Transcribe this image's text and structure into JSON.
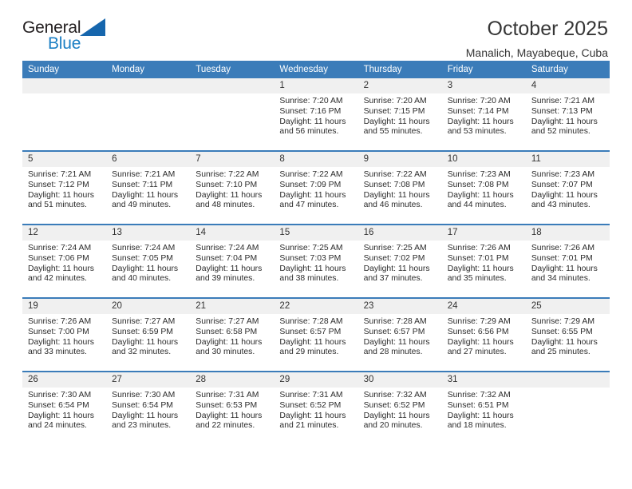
{
  "brand": {
    "name_top": "General",
    "name_bottom": "Blue",
    "accent_color": "#1666ad",
    "blue_text_color": "#1b7fc4"
  },
  "header": {
    "title": "October 2025",
    "subtitle": "Manalich, Mayabeque, Cuba"
  },
  "calendar": {
    "header_bg": "#3B7CB9",
    "daynum_bg": "#F0F0F0",
    "weekday_headers": [
      "Sunday",
      "Monday",
      "Tuesday",
      "Wednesday",
      "Thursday",
      "Friday",
      "Saturday"
    ],
    "weeks": [
      [
        {
          "day": "",
          "sunrise": "",
          "sunset": "",
          "daylight_line1": "",
          "daylight_line2": ""
        },
        {
          "day": "",
          "sunrise": "",
          "sunset": "",
          "daylight_line1": "",
          "daylight_line2": ""
        },
        {
          "day": "",
          "sunrise": "",
          "sunset": "",
          "daylight_line1": "",
          "daylight_line2": ""
        },
        {
          "day": "1",
          "sunrise": "Sunrise: 7:20 AM",
          "sunset": "Sunset: 7:16 PM",
          "daylight_line1": "Daylight: 11 hours",
          "daylight_line2": "and 56 minutes."
        },
        {
          "day": "2",
          "sunrise": "Sunrise: 7:20 AM",
          "sunset": "Sunset: 7:15 PM",
          "daylight_line1": "Daylight: 11 hours",
          "daylight_line2": "and 55 minutes."
        },
        {
          "day": "3",
          "sunrise": "Sunrise: 7:20 AM",
          "sunset": "Sunset: 7:14 PM",
          "daylight_line1": "Daylight: 11 hours",
          "daylight_line2": "and 53 minutes."
        },
        {
          "day": "4",
          "sunrise": "Sunrise: 7:21 AM",
          "sunset": "Sunset: 7:13 PM",
          "daylight_line1": "Daylight: 11 hours",
          "daylight_line2": "and 52 minutes."
        }
      ],
      [
        {
          "day": "5",
          "sunrise": "Sunrise: 7:21 AM",
          "sunset": "Sunset: 7:12 PM",
          "daylight_line1": "Daylight: 11 hours",
          "daylight_line2": "and 51 minutes."
        },
        {
          "day": "6",
          "sunrise": "Sunrise: 7:21 AM",
          "sunset": "Sunset: 7:11 PM",
          "daylight_line1": "Daylight: 11 hours",
          "daylight_line2": "and 49 minutes."
        },
        {
          "day": "7",
          "sunrise": "Sunrise: 7:22 AM",
          "sunset": "Sunset: 7:10 PM",
          "daylight_line1": "Daylight: 11 hours",
          "daylight_line2": "and 48 minutes."
        },
        {
          "day": "8",
          "sunrise": "Sunrise: 7:22 AM",
          "sunset": "Sunset: 7:09 PM",
          "daylight_line1": "Daylight: 11 hours",
          "daylight_line2": "and 47 minutes."
        },
        {
          "day": "9",
          "sunrise": "Sunrise: 7:22 AM",
          "sunset": "Sunset: 7:08 PM",
          "daylight_line1": "Daylight: 11 hours",
          "daylight_line2": "and 46 minutes."
        },
        {
          "day": "10",
          "sunrise": "Sunrise: 7:23 AM",
          "sunset": "Sunset: 7:08 PM",
          "daylight_line1": "Daylight: 11 hours",
          "daylight_line2": "and 44 minutes."
        },
        {
          "day": "11",
          "sunrise": "Sunrise: 7:23 AM",
          "sunset": "Sunset: 7:07 PM",
          "daylight_line1": "Daylight: 11 hours",
          "daylight_line2": "and 43 minutes."
        }
      ],
      [
        {
          "day": "12",
          "sunrise": "Sunrise: 7:24 AM",
          "sunset": "Sunset: 7:06 PM",
          "daylight_line1": "Daylight: 11 hours",
          "daylight_line2": "and 42 minutes."
        },
        {
          "day": "13",
          "sunrise": "Sunrise: 7:24 AM",
          "sunset": "Sunset: 7:05 PM",
          "daylight_line1": "Daylight: 11 hours",
          "daylight_line2": "and 40 minutes."
        },
        {
          "day": "14",
          "sunrise": "Sunrise: 7:24 AM",
          "sunset": "Sunset: 7:04 PM",
          "daylight_line1": "Daylight: 11 hours",
          "daylight_line2": "and 39 minutes."
        },
        {
          "day": "15",
          "sunrise": "Sunrise: 7:25 AM",
          "sunset": "Sunset: 7:03 PM",
          "daylight_line1": "Daylight: 11 hours",
          "daylight_line2": "and 38 minutes."
        },
        {
          "day": "16",
          "sunrise": "Sunrise: 7:25 AM",
          "sunset": "Sunset: 7:02 PM",
          "daylight_line1": "Daylight: 11 hours",
          "daylight_line2": "and 37 minutes."
        },
        {
          "day": "17",
          "sunrise": "Sunrise: 7:26 AM",
          "sunset": "Sunset: 7:01 PM",
          "daylight_line1": "Daylight: 11 hours",
          "daylight_line2": "and 35 minutes."
        },
        {
          "day": "18",
          "sunrise": "Sunrise: 7:26 AM",
          "sunset": "Sunset: 7:01 PM",
          "daylight_line1": "Daylight: 11 hours",
          "daylight_line2": "and 34 minutes."
        }
      ],
      [
        {
          "day": "19",
          "sunrise": "Sunrise: 7:26 AM",
          "sunset": "Sunset: 7:00 PM",
          "daylight_line1": "Daylight: 11 hours",
          "daylight_line2": "and 33 minutes."
        },
        {
          "day": "20",
          "sunrise": "Sunrise: 7:27 AM",
          "sunset": "Sunset: 6:59 PM",
          "daylight_line1": "Daylight: 11 hours",
          "daylight_line2": "and 32 minutes."
        },
        {
          "day": "21",
          "sunrise": "Sunrise: 7:27 AM",
          "sunset": "Sunset: 6:58 PM",
          "daylight_line1": "Daylight: 11 hours",
          "daylight_line2": "and 30 minutes."
        },
        {
          "day": "22",
          "sunrise": "Sunrise: 7:28 AM",
          "sunset": "Sunset: 6:57 PM",
          "daylight_line1": "Daylight: 11 hours",
          "daylight_line2": "and 29 minutes."
        },
        {
          "day": "23",
          "sunrise": "Sunrise: 7:28 AM",
          "sunset": "Sunset: 6:57 PM",
          "daylight_line1": "Daylight: 11 hours",
          "daylight_line2": "and 28 minutes."
        },
        {
          "day": "24",
          "sunrise": "Sunrise: 7:29 AM",
          "sunset": "Sunset: 6:56 PM",
          "daylight_line1": "Daylight: 11 hours",
          "daylight_line2": "and 27 minutes."
        },
        {
          "day": "25",
          "sunrise": "Sunrise: 7:29 AM",
          "sunset": "Sunset: 6:55 PM",
          "daylight_line1": "Daylight: 11 hours",
          "daylight_line2": "and 25 minutes."
        }
      ],
      [
        {
          "day": "26",
          "sunrise": "Sunrise: 7:30 AM",
          "sunset": "Sunset: 6:54 PM",
          "daylight_line1": "Daylight: 11 hours",
          "daylight_line2": "and 24 minutes."
        },
        {
          "day": "27",
          "sunrise": "Sunrise: 7:30 AM",
          "sunset": "Sunset: 6:54 PM",
          "daylight_line1": "Daylight: 11 hours",
          "daylight_line2": "and 23 minutes."
        },
        {
          "day": "28",
          "sunrise": "Sunrise: 7:31 AM",
          "sunset": "Sunset: 6:53 PM",
          "daylight_line1": "Daylight: 11 hours",
          "daylight_line2": "and 22 minutes."
        },
        {
          "day": "29",
          "sunrise": "Sunrise: 7:31 AM",
          "sunset": "Sunset: 6:52 PM",
          "daylight_line1": "Daylight: 11 hours",
          "daylight_line2": "and 21 minutes."
        },
        {
          "day": "30",
          "sunrise": "Sunrise: 7:32 AM",
          "sunset": "Sunset: 6:52 PM",
          "daylight_line1": "Daylight: 11 hours",
          "daylight_line2": "and 20 minutes."
        },
        {
          "day": "31",
          "sunrise": "Sunrise: 7:32 AM",
          "sunset": "Sunset: 6:51 PM",
          "daylight_line1": "Daylight: 11 hours",
          "daylight_line2": "and 18 minutes."
        },
        {
          "day": "",
          "sunrise": "",
          "sunset": "",
          "daylight_line1": "",
          "daylight_line2": ""
        }
      ]
    ]
  }
}
